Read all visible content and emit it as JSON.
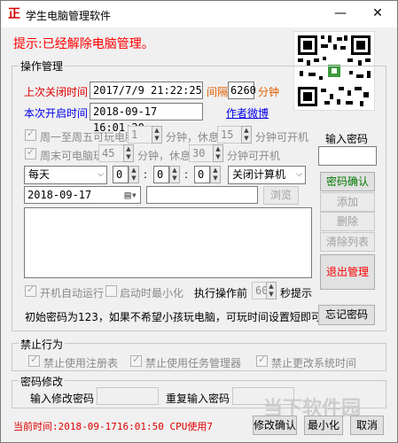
{
  "window": {
    "title": "学生电脑管理软件",
    "app_icon": "正"
  },
  "tip": "提示:已经解除电脑管理。",
  "ops_group": {
    "label": "操作管理"
  },
  "last_close_label": "上次关闭时间",
  "last_close_value": "2017/7/9 21:22:25",
  "interval_label": "间隔",
  "interval_value": "6260",
  "minute_unit": "分钟",
  "this_open_label": "本次开启时间",
  "this_open_value": "2018-09-17 16:01:20",
  "author_link": "作者微博",
  "weekday_check": "周一至周五可玩电脑",
  "weekday_minutes": "1",
  "weekday_rest": "15",
  "weekend_check": "周末可电脑玩",
  "weekend_minutes": "45",
  "weekend_rest": "30",
  "text_minutes": "分钟，休息",
  "text_can_open": "分钟可开机",
  "password_label": "输入密码",
  "password_confirm": "密码确认",
  "btn_add": "添加",
  "btn_delete": "删除",
  "btn_clear": "清除列表",
  "btn_exit": "退出管理",
  "btn_forgot": "忘记密码",
  "freq_select": "每天",
  "time_h": "0",
  "time_m": "0",
  "time_s": "0",
  "action_select": "关闭计算机",
  "date_value": "2018-09-17",
  "browse_button": "浏览",
  "autostart_check": "开机自动运行",
  "minimize_check": "启动时最小化",
  "before_exec_label": "执行操作前",
  "before_exec_value": "60",
  "seconds_tip": "秒提示",
  "info_text": "初始密码为123，如果不希望小孩玩电脑，可玩时间设置短即可。",
  "forbid_group": {
    "label": "禁止行为"
  },
  "forbid_regedit": "禁止使用注册表",
  "forbid_taskmgr": "禁止使用任务管理器",
  "forbid_time": "禁止更改系统时间",
  "pwd_group": {
    "label": "密码修改"
  },
  "new_pwd_label": "输入修改密码",
  "repeat_pwd_label": "重复输入密码",
  "status_text": "当前时间:2018-09-1716:01:50 CPU使用7",
  "btn_modify": "修改确认",
  "btn_minimize": "最小化",
  "btn_cancel": "取消",
  "watermark": "当下软件园",
  "colors": {
    "accent_red": "#ff0000",
    "link_blue": "#0000ee",
    "confirm_green": "#007a00"
  }
}
